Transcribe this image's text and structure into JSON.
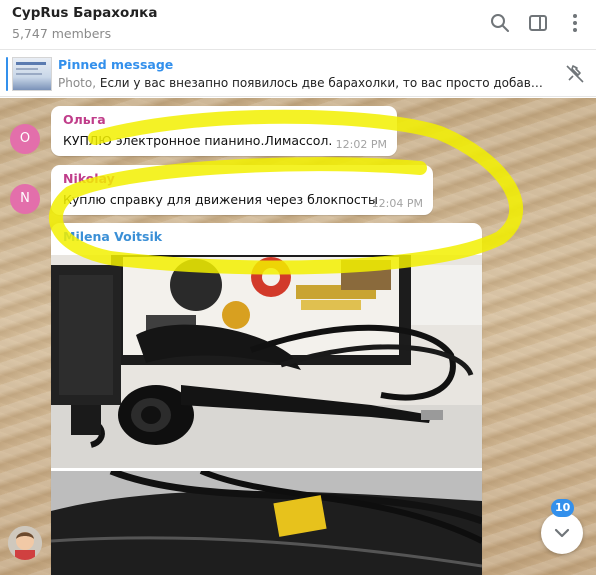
{
  "header": {
    "title": "CypRus Барахолка",
    "subtitle": "5,747 members",
    "icons": [
      "search-icon",
      "sidebar-toggle-icon",
      "more-vertical-icon"
    ]
  },
  "pinned": {
    "label": "Pinned message",
    "prefix": "Photo,",
    "text": "Если у вас внезапно появилось две барахолки, то вас просто добави...",
    "icon": "unpin-icon"
  },
  "messages": [
    {
      "sender": "Ольга",
      "initial": "O",
      "text": "КУПЛЮ электронное пианино.Лимассол.",
      "time": "12:02 PM",
      "sender_color": "#c03d8a",
      "avatar_color": "#e36fab"
    },
    {
      "sender": "Nikolay",
      "initial": "N",
      "text": "Куплю справку для движения через блокпосты",
      "time": "12:04 PM",
      "sender_color": "#c03d8a",
      "avatar_color": "#e36fab"
    },
    {
      "sender": "Milena Voitsik",
      "sender_color": "#3a8fd6",
      "media": [
        "photo",
        "photo"
      ]
    }
  ],
  "scroll_down": {
    "badge": "10",
    "icon": "chevron-down-icon"
  },
  "colors": {
    "accent": "#3390ec",
    "highlight": "#f2f000"
  }
}
